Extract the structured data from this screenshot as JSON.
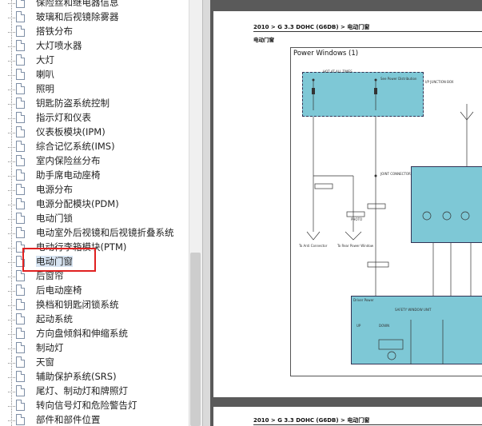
{
  "nav": {
    "items": [
      {
        "label": "保险丝和继电器信息"
      },
      {
        "label": "玻璃和后视镜除雾器"
      },
      {
        "label": "搭铁分布"
      },
      {
        "label": "大灯喷水器"
      },
      {
        "label": "大灯"
      },
      {
        "label": "喇叭"
      },
      {
        "label": "照明"
      },
      {
        "label": "钥匙防盗系统控制"
      },
      {
        "label": "指示灯和仪表"
      },
      {
        "label": "仪表板模块(IPM)"
      },
      {
        "label": "综合记忆系统(IMS)"
      },
      {
        "label": "室内保险丝分布"
      },
      {
        "label": "助手席电动座椅"
      },
      {
        "label": "电源分布"
      },
      {
        "label": "电源分配模块(PDM)"
      },
      {
        "label": "电动门锁"
      },
      {
        "label": "电动室外后视镜和后视镜折叠系统"
      },
      {
        "label": "电动行李箱模块(PTM)"
      },
      {
        "label": "电动门窗",
        "selected": true
      },
      {
        "label": "后窗帘"
      },
      {
        "label": "后电动座椅"
      },
      {
        "label": "换档和钥匙闭锁系统"
      },
      {
        "label": "起动系统"
      },
      {
        "label": "方向盘倾斜和伸缩系统"
      },
      {
        "label": "制动灯"
      },
      {
        "label": "天窗"
      },
      {
        "label": "辅助保护系统(SRS)"
      },
      {
        "label": "尾灯、制动灯和牌照灯"
      },
      {
        "label": "转向信号灯和危险警告灯"
      },
      {
        "label": "部件和部件位置"
      }
    ]
  },
  "document": {
    "page1_header": "2010 > G 3.3 DOHC (G6DB) > 电动门窗",
    "page1_subtitle": "电动门窗",
    "diagram_title": "Power Windows (1)",
    "page2_header": "2010 > G 3.3 DOHC (G6DB) > 电动门窗",
    "labels": {
      "hot_at_all_times": "HOT AT ALL TIMES",
      "see_power_distribution": "See Power Distribution",
      "ij_junction_box": "I/P JUNCTION BOX",
      "ij_connector": "JOINT CONNECTOR",
      "to_rear_power_window": "To Rear Power Window",
      "to_anti_connector": "To Anti Connector",
      "safety_window_unit": "SAFETY WINDOW UNIT",
      "driver_power": "Driver Power",
      "up": "UP",
      "down": "DOWN",
      "photo": "PHOTO"
    }
  },
  "colors": {
    "highlight": "#e02020",
    "diagram_fill": "#7ec8d6"
  }
}
